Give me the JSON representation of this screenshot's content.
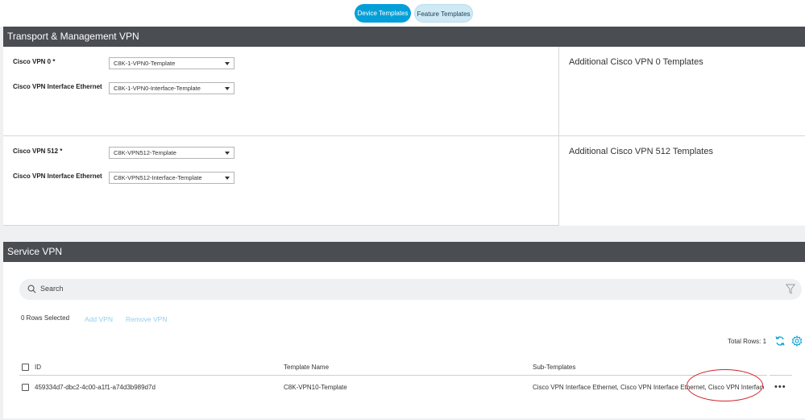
{
  "tabs": {
    "device_templates": "Device Templates",
    "feature_templates": "Feature Templates"
  },
  "transport": {
    "header": "Transport & Management VPN",
    "vpn0": {
      "label": "Cisco VPN 0 *",
      "value": "C8K-1-VPN0-Template",
      "iface_label": "Cisco VPN Interface Ethernet",
      "iface_value": "C8K-1-VPN0-Interface-Template",
      "additional": "Additional Cisco VPN 0 Templates"
    },
    "vpn512": {
      "label": "Cisco VPN 512 *",
      "value": "C8K-VPN512-Template",
      "iface_label": "Cisco VPN Interface Ethernet",
      "iface_value": "C8K-VPN512-Interface-Template",
      "additional": "Additional Cisco VPN 512 Templates"
    }
  },
  "service": {
    "header": "Service VPN",
    "search_placeholder": "Search",
    "rows_selected": "0 Rows Selected",
    "add_vpn": "Add VPN",
    "remove_vpn": "Remove VPN",
    "total_rows": "Total Rows: 1",
    "columns": {
      "id": "ID",
      "template_name": "Template Name",
      "sub_templates": "Sub-Templates"
    },
    "rows": [
      {
        "id": "459334d7-dbc2-4c00-a1f1-a74d3b989d7d",
        "template_name": "C8K-VPN10-Template",
        "sub_templates": "Cisco VPN Interface Ethernet, Cisco VPN Interface Ethernet, Cisco VPN Interface IPsec",
        "more": "•••"
      }
    ]
  },
  "colors": {
    "accent": "#049fd9",
    "header_bg": "#4a4d52",
    "annotation": "#d0242b"
  }
}
